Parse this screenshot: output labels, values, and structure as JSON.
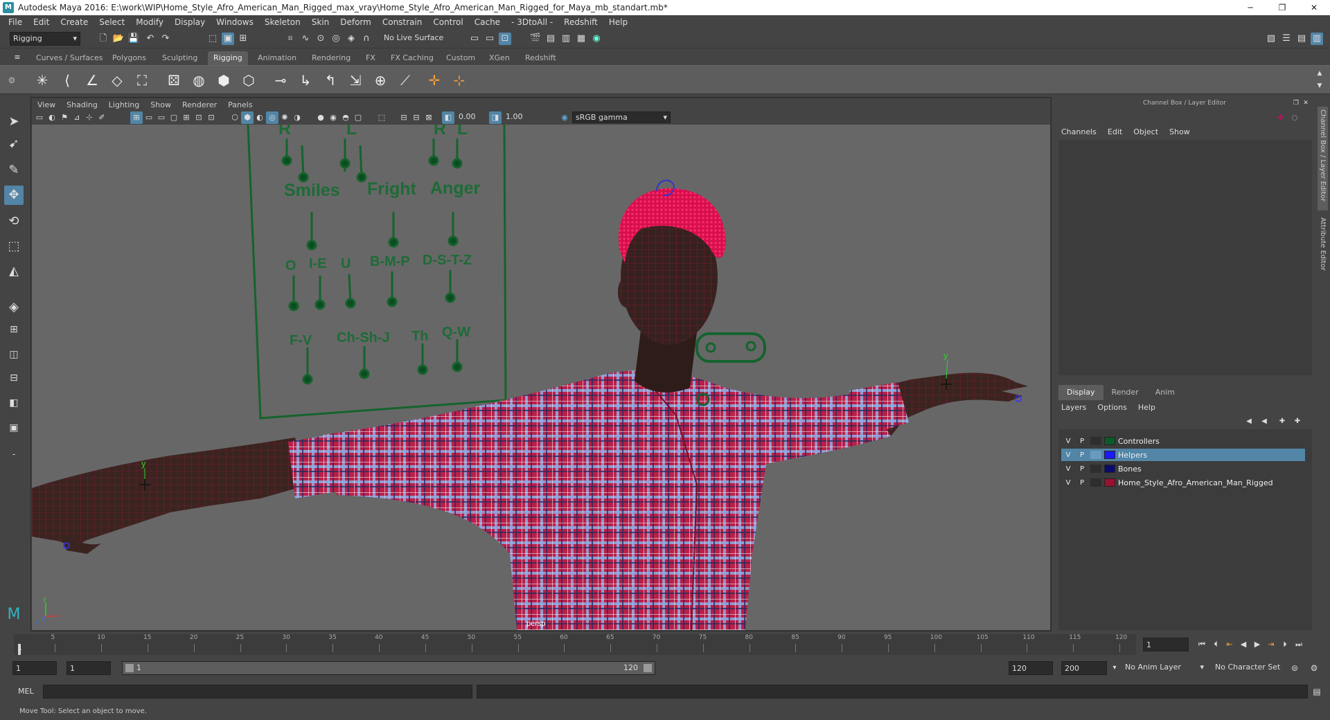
{
  "window": {
    "title": "Autodesk Maya 2016: E:\\work\\WIP\\Home_Style_Afro_American_Man_Rigged_max_vray\\Home_Style_Afro_American_Man_Rigged_for_Maya_mb_standart.mb*",
    "minimize": "─",
    "maximize": "❐",
    "close": "✕"
  },
  "menubar": [
    "File",
    "Edit",
    "Create",
    "Select",
    "Modify",
    "Display",
    "Windows",
    "Skeleton",
    "Skin",
    "Deform",
    "Constrain",
    "Control",
    "Cache",
    "- 3DtoAll -",
    "Redshift",
    "Help"
  ],
  "statusline": {
    "mode": "Rigging",
    "live_surface": "No Live Surface"
  },
  "shelf_tabs": [
    "Curves / Surfaces",
    "Polygons",
    "Sculpting",
    "Rigging",
    "Animation",
    "Rendering",
    "FX",
    "FX Caching",
    "Custom",
    "XGen",
    "Redshift"
  ],
  "active_shelf_tab": "Rigging",
  "viewport": {
    "menu": [
      "View",
      "Shading",
      "Lighting",
      "Show",
      "Renderer",
      "Panels"
    ],
    "exposure": "0.00",
    "gamma": "1.00",
    "color_space": "sRGB gamma",
    "camera_label": "persp",
    "facial_panel": {
      "top_labels": [
        "R",
        "L",
        "R",
        "L"
      ],
      "row1": [
        "Smiles",
        "Fright",
        "Anger"
      ],
      "row2": [
        "O",
        "I-E",
        "U",
        "B-M-P",
        "D-S-T-Z"
      ],
      "row3": [
        "F-V",
        "Ch-Sh-J",
        "Th",
        "Q-W"
      ]
    },
    "axis_y_label": "y",
    "axis_x_label": "x",
    "axis_z_label": "z"
  },
  "channel_box": {
    "title": "Channel Box / Layer Editor",
    "menu": [
      "Channels",
      "Edit",
      "Object",
      "Show"
    ],
    "layer_tabs": [
      "Display",
      "Render",
      "Anim"
    ],
    "active_layer_tab": "Display",
    "layer_menu": [
      "Layers",
      "Options",
      "Help"
    ],
    "layers": [
      {
        "v": "V",
        "p": "P",
        "color": "#0b5a2a",
        "name": "Controllers",
        "selected": false
      },
      {
        "v": "V",
        "p": "P",
        "color": "#1a1aff",
        "name": "Helpers",
        "selected": true
      },
      {
        "v": "V",
        "p": "P",
        "color": "#0a0a6e",
        "name": "Bones",
        "selected": false
      },
      {
        "v": "V",
        "p": "P",
        "color": "#9a1030",
        "name": "Home_Style_Afro_American_Man_Rigged",
        "selected": false
      }
    ],
    "side_tab_1": "Channel Box / Layer Editor",
    "side_tab_2": "Attribute Editor"
  },
  "timeline": {
    "ticks": [
      "5",
      "10",
      "15",
      "20",
      "25",
      "30",
      "35",
      "40",
      "45",
      "50",
      "55",
      "60",
      "65",
      "70",
      "75",
      "80",
      "85",
      "90",
      "95",
      "100",
      "105",
      "110",
      "115",
      "120"
    ],
    "start_marker": "1",
    "current_frame": "1"
  },
  "range": {
    "start": "1",
    "start_inner": "1",
    "slider_start": "1",
    "slider_end": "120",
    "end_inner": "120",
    "end": "200",
    "anim_layer": "No Anim Layer",
    "character_set": "No Character Set"
  },
  "command_line": {
    "label": "MEL"
  },
  "help_line": "Move Tool: Select an object to move."
}
